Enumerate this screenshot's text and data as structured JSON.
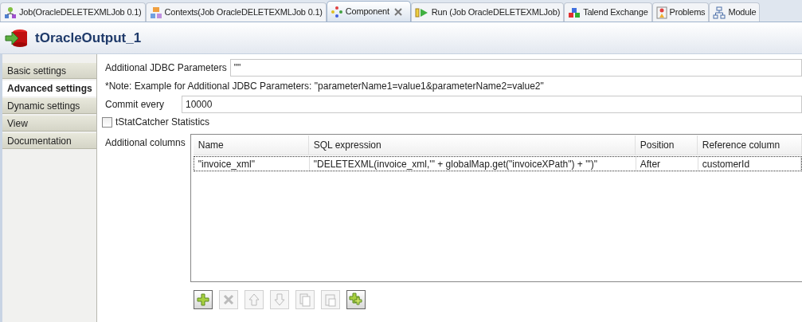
{
  "tabs": [
    {
      "label": "Job(OracleDELETEXMLJob 0.1)",
      "kind": "job",
      "selected": false,
      "closable": false
    },
    {
      "label": "Contexts(Job OracleDELETEXMLJob 0.1)",
      "kind": "contexts",
      "selected": false,
      "closable": false
    },
    {
      "label": "Component",
      "kind": "component",
      "selected": true,
      "closable": true
    },
    {
      "label": "Run (Job OracleDELETEXMLJob)",
      "kind": "run",
      "selected": false,
      "closable": false
    },
    {
      "label": "Talend Exchange",
      "kind": "exchange",
      "selected": false,
      "closable": false
    },
    {
      "label": "Problems",
      "kind": "problems",
      "selected": false,
      "closable": false
    },
    {
      "label": "Module",
      "kind": "modules",
      "selected": false,
      "closable": false
    }
  ],
  "component": {
    "title": "tOracleOutput_1"
  },
  "sidebar": {
    "items": [
      {
        "label": "Basic settings",
        "selected": false
      },
      {
        "label": "Advanced settings",
        "selected": true
      },
      {
        "label": "Dynamic settings",
        "selected": false
      },
      {
        "label": "View",
        "selected": false
      },
      {
        "label": "Documentation",
        "selected": false
      }
    ]
  },
  "settings": {
    "jdbc_label": "Additional JDBC Parameters",
    "jdbc_value": "\"\"",
    "note": "*Note: Example for Additional JDBC Parameters: \"parameterName1=value1&parameterName2=value2\"",
    "commit_label": "Commit every",
    "commit_value": "10000",
    "stat_label": "tStatCatcher Statistics",
    "stat_checked": false,
    "columns_label": "Additional columns"
  },
  "table": {
    "columns": [
      "Name",
      "SQL expression",
      "Position",
      "Reference column"
    ],
    "rows": [
      {
        "cells": [
          "\"invoice_xml\"",
          "\"DELETEXML(invoice_xml,'\" + globalMap.get(\"invoiceXPath\")  + \"')\"",
          "After",
          "customerId"
        ],
        "selected": true
      }
    ]
  },
  "toolbar": [
    {
      "kind": "add",
      "disabled": false
    },
    {
      "kind": "delete",
      "disabled": true
    },
    {
      "kind": "up",
      "disabled": true
    },
    {
      "kind": "down",
      "disabled": true
    },
    {
      "kind": "copy",
      "disabled": true
    },
    {
      "kind": "paste",
      "disabled": true
    },
    {
      "kind": "add-all",
      "disabled": false
    }
  ]
}
